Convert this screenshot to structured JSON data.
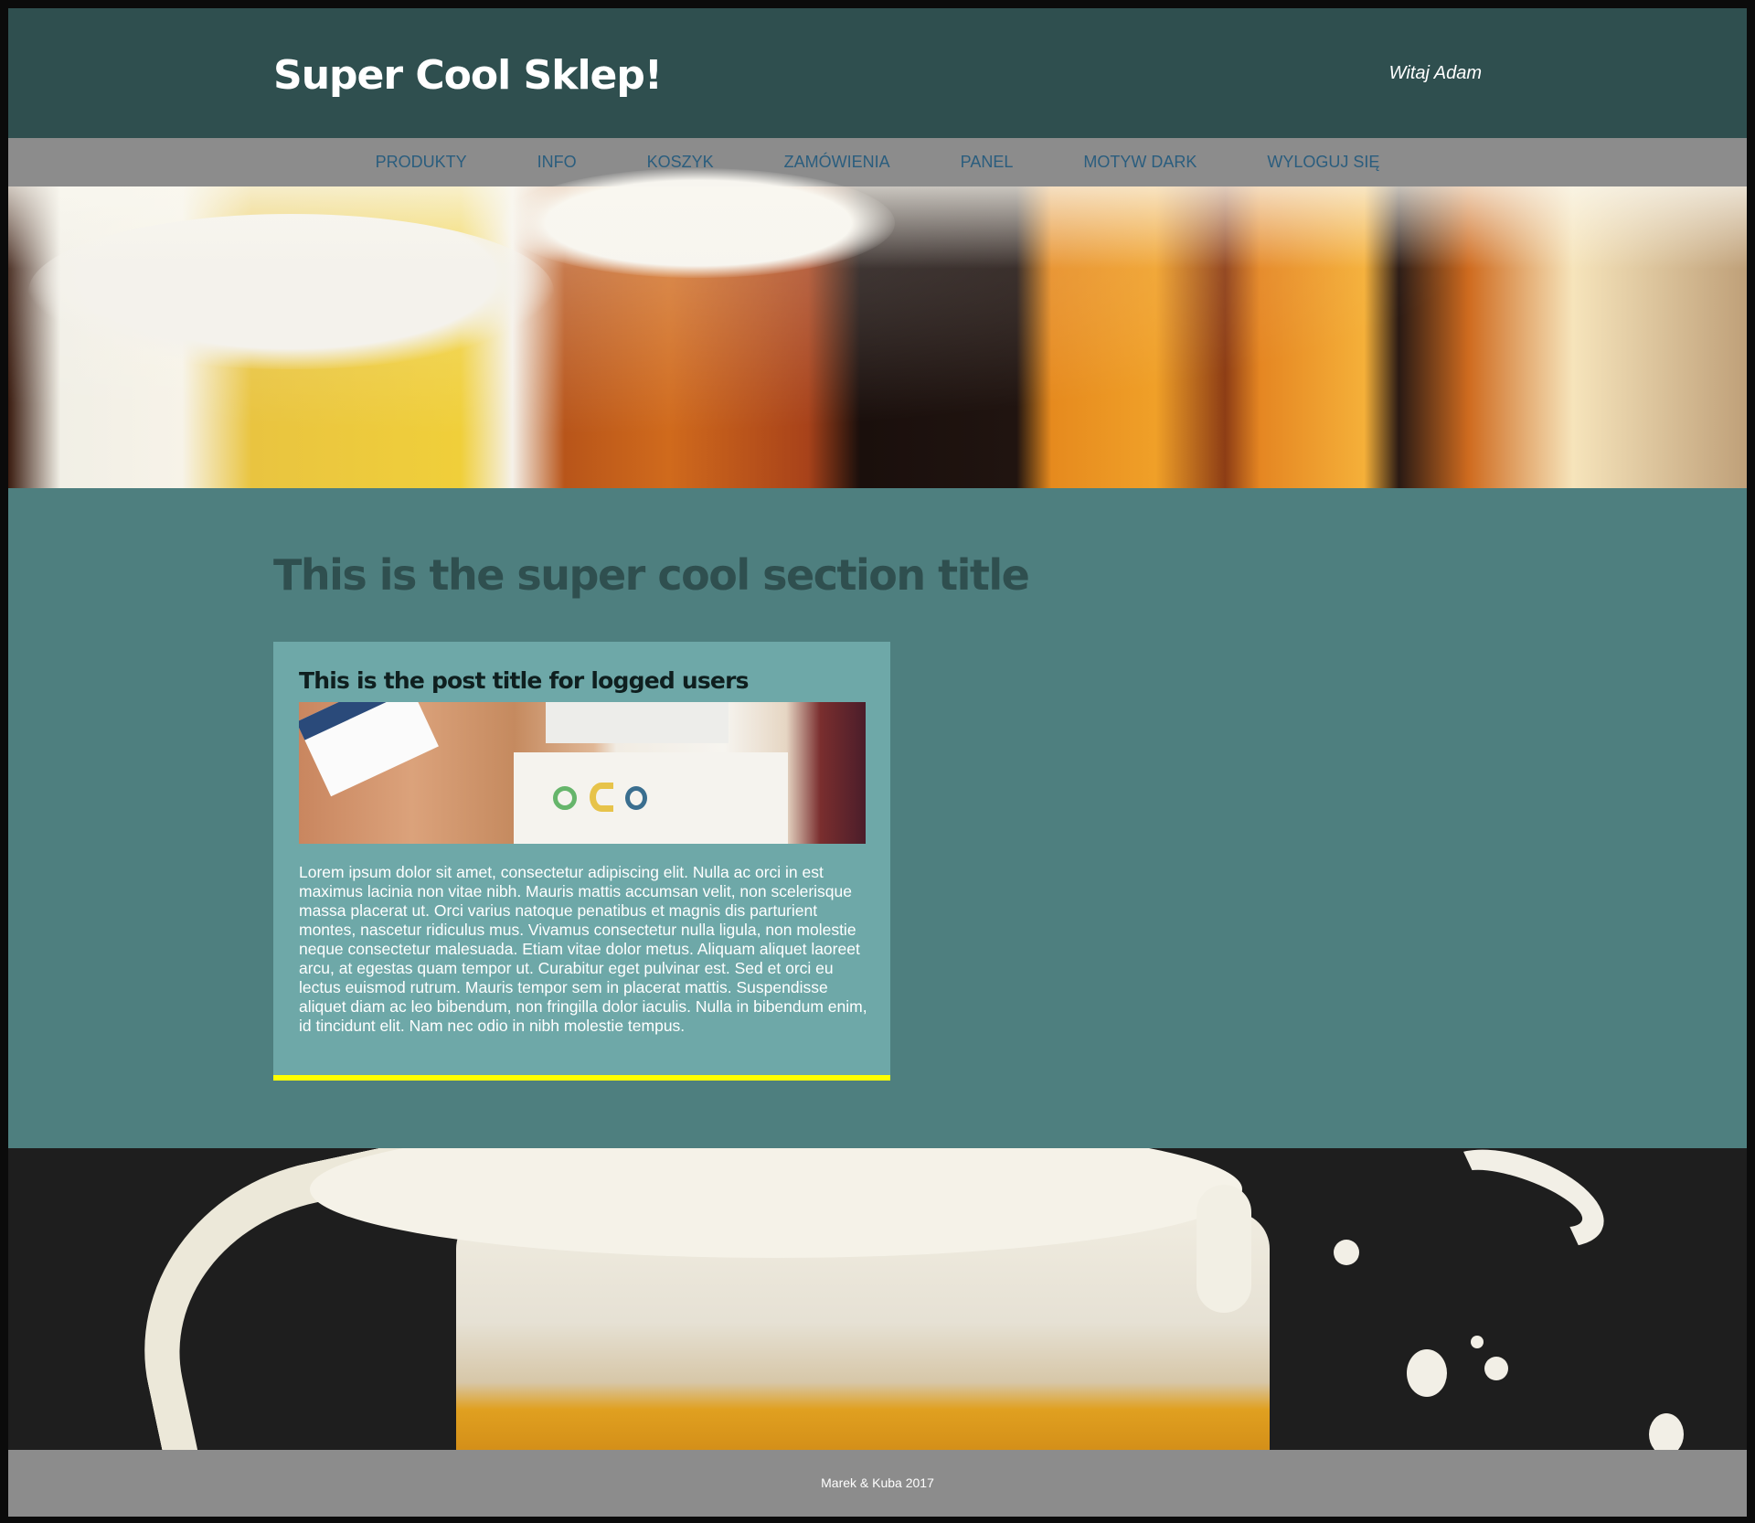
{
  "header": {
    "site_title": "Super Cool Sklep!",
    "greeting": "Witaj Adam"
  },
  "nav": {
    "items": [
      {
        "label": "PRODUKTY"
      },
      {
        "label": "INFO"
      },
      {
        "label": "KOSZYK"
      },
      {
        "label": "ZAMÓWIENIA"
      },
      {
        "label": "PANEL"
      },
      {
        "label": "MOTYW DARK"
      },
      {
        "label": "WYLOGUJ SIĘ"
      }
    ]
  },
  "main": {
    "section_title": "This is the super cool section title",
    "post": {
      "title": "This is the post title for logged users",
      "image_icon": "magazine-desk-photo",
      "body": "Lorem ipsum dolor sit amet, consectetur adipiscing elit. Nulla ac orci in est maximus lacinia non vitae nibh. Mauris mattis accumsan velit, non scelerisque massa placerat ut. Orci varius natoque penatibus et magnis dis parturient montes, nascetur ridiculus mus. Vivamus consectetur nulla ligula, non molestie neque consectetur malesuada. Etiam vitae dolor metus. Aliquam aliquet laoreet arcu, at egestas quam tempor ut. Curabitur eget pulvinar est. Sed et orci eu lectus euismod rutrum. Mauris tempor sem in placerat mattis. Suspendisse aliquet diam ac leo bibendum, non fringilla dolor iaculis. Nulla in bibendum enim, id tincidunt elit. Nam nec odio in nibh molestie tempus."
    }
  },
  "footer": {
    "text": "Marek & Kuba 2017"
  },
  "colors": {
    "header_bg": "#2f4f4f",
    "nav_bg": "#8c8c8c",
    "nav_link": "#2a5d7e",
    "main_bg": "#4e7f7f",
    "post_bg": "#6ea8a8",
    "post_accent": "#ffff00"
  }
}
